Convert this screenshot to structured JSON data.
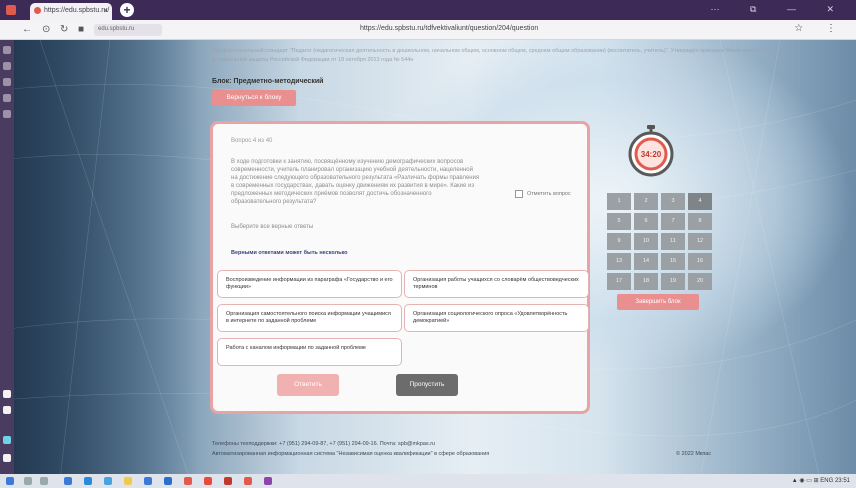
{
  "browser": {
    "tab_title": "https://edu.spbstu.ru/",
    "url": "https://edu.spbstu.ru/tdfvektivaliunt/question/204/question",
    "new_tab_symbol": "+",
    "close_symbol": "×",
    "address_chip": "edu.spbstu.ru",
    "window_controls": "⋯ ⧉ — ✕",
    "address_icons": "☆ ⋮"
  },
  "page": {
    "top_text": "Профессиональный стандарт \"Педагог (педагогическая деятельность в дошкольном, начальном общем, основном общем, среднем общем образовании) (воспитатель, учитель)\". Утверждён приказом Министерства труда и социальной защиты Российской Федерации от 18 октября 2013 года № 544н",
    "block_label": "Блок: Предметно-методический",
    "return_button": "Вернуться к блоку"
  },
  "question": {
    "number": "Вопрос 4 из 40",
    "text": "В ходе подготовки к занятию, посвящённому изучению демографических вопросов современности, учитель планировал организацию учебной деятельности, нацеленной на достижение следующего образовательного результата «Различать формы правления в современных государствах, давать оценку движениям их развития в мире». Какие из предложенных методических приёмов позволят достичь обозначенного образовательного результата?",
    "flag_label": "Отметить вопрос",
    "instruction": "Выберите все верные ответы",
    "hint": "Верными ответами может быть несколько",
    "options": [
      "Воспроизведение информации из параграфа «Государство и его функции»",
      "Организация работы учащихся со словарём обществоведческих терминов",
      "Организация самостоятельного поиска информации учащимися в интернете по заданной проблеме",
      "Организация социологического опроса «Удовлетворённость демократией»",
      "Работа с каналом информации по заданной проблеме"
    ],
    "answer_button": "Ответить",
    "skip_button": "Пропустить"
  },
  "timer": {
    "display": "34:20",
    "accent": "#e05b4e"
  },
  "question_grid": {
    "cells": [
      "1",
      "2",
      "3",
      "4",
      "5",
      "6",
      "7",
      "8",
      "9",
      "10",
      "11",
      "12",
      "13",
      "14",
      "15",
      "16",
      "17",
      "18",
      "19",
      "20"
    ],
    "current": "4"
  },
  "finish_button": "Завершить блок",
  "footer": {
    "line1": "Телефоны техподдержки: +7 (951) 294-09-87, +7 (951) 294-09-16. Почта: spb@mkpas.ru",
    "line2": "Автоматизированная информационная система \"Независимая оценка квалификации\" в сфере образования",
    "right": "© 2022 Мкпас"
  },
  "taskbar": {
    "tray": "▲ ◉ ▭ ⊞ ENG 23:51"
  },
  "colors": {
    "accent_pink": "#e98f8f",
    "card_border": "#e8a4a4",
    "grid_cell": "#9aa0a4",
    "skip_gray": "#6c6c6c",
    "tabbar": "#3d2a56"
  }
}
